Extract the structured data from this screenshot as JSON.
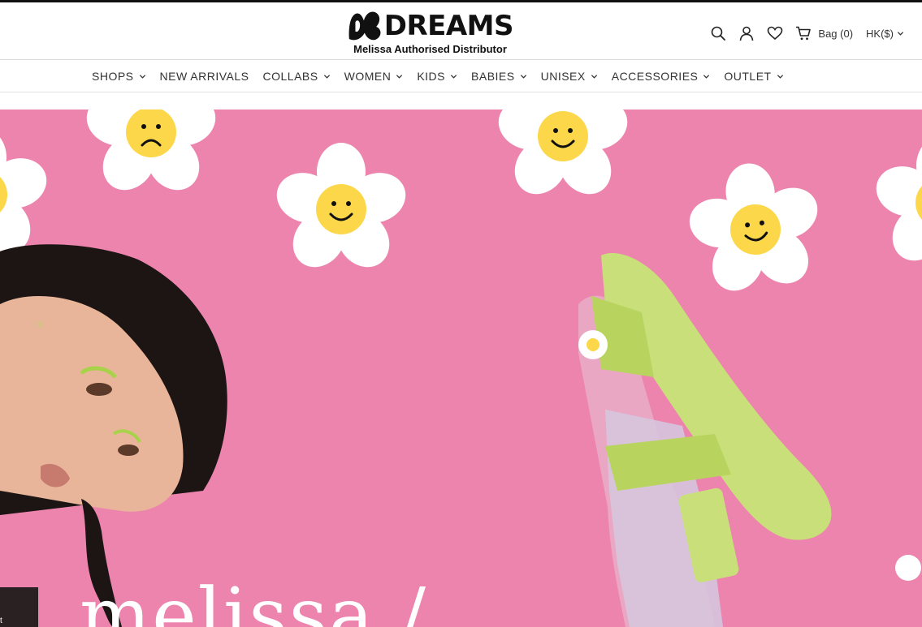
{
  "brand": {
    "name": "DREAMS",
    "tagline": "Melissa Authorised Distributor"
  },
  "utilities": {
    "search_icon": "search-icon",
    "account_icon": "user-icon",
    "wishlist_icon": "heart-icon",
    "bag_icon": "shopping-bag-icon",
    "bag_label": "Bag (0)",
    "currency_label": "HK($)"
  },
  "nav": {
    "items": [
      {
        "label": "SHOPS",
        "has_dropdown": true
      },
      {
        "label": "NEW ARRIVALS",
        "has_dropdown": false
      },
      {
        "label": "COLLABS",
        "has_dropdown": true
      },
      {
        "label": "WOMEN",
        "has_dropdown": true
      },
      {
        "label": "KIDS",
        "has_dropdown": true
      },
      {
        "label": "BABIES",
        "has_dropdown": true
      },
      {
        "label": "UNISEX",
        "has_dropdown": true
      },
      {
        "label": "ACCESSORIES",
        "has_dropdown": true
      },
      {
        "label": "OUTLET",
        "has_dropdown": true
      }
    ]
  },
  "hero": {
    "headline": "melissa /",
    "colors": {
      "background": "#ec84ad",
      "petal": "#ffffff",
      "flower_center": "#fbd749",
      "shoe": "#c9e07a",
      "hair": "#1c1514",
      "skin": "#e8b59a"
    }
  },
  "chat": {
    "label": "t"
  }
}
